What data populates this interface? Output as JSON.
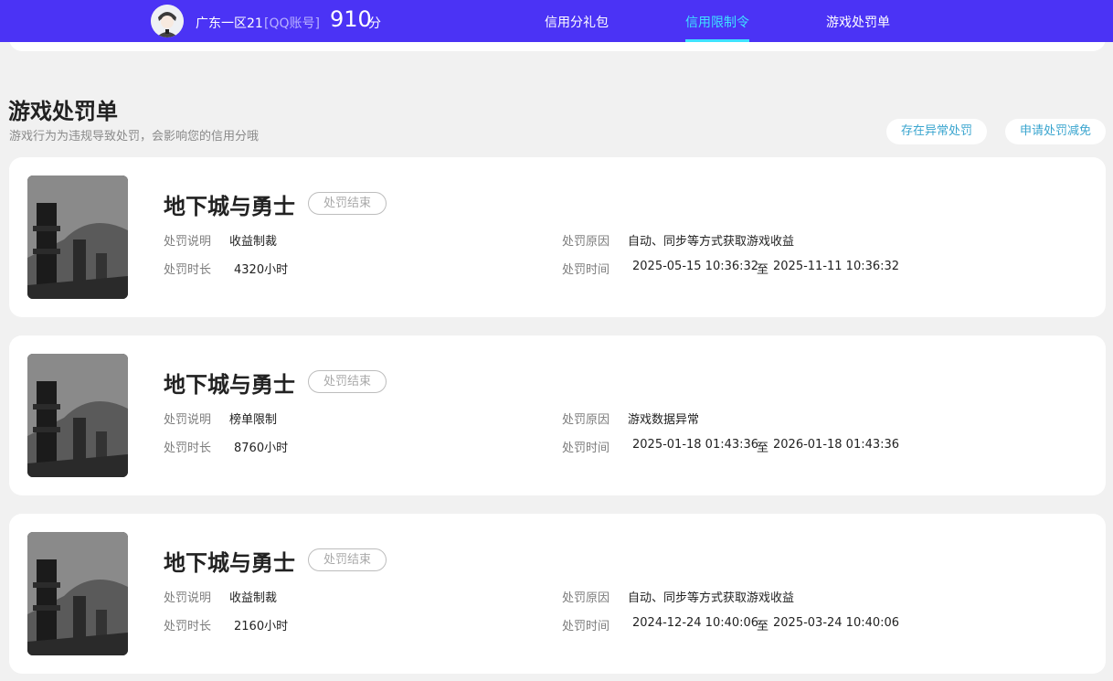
{
  "header": {
    "user_name": "广东一区21",
    "account_type": "[QQ账号]",
    "score": "910",
    "score_unit": "分",
    "tabs": [
      {
        "label": "信用分礼包",
        "active": false
      },
      {
        "label": "信用限制令",
        "active": true
      },
      {
        "label": "游戏处罚单",
        "active": false
      }
    ],
    "accent_color": "#4b33f5",
    "active_color": "#3fe3ff"
  },
  "section": {
    "title": "游戏处罚单",
    "subtitle": "游戏行为为违规导致处罚，会影响您的信用分哦",
    "buttons": {
      "abnormal": "存在异常处罚",
      "appeal": "申请处罚减免"
    }
  },
  "labels": {
    "desc": "处罚说明",
    "reason": "处罚原因",
    "duration": "处罚时长",
    "time": "处罚时间",
    "to": "至"
  },
  "penalties": [
    {
      "game": "地下城与勇士",
      "status": "处罚结束",
      "desc": "收益制裁",
      "reason": "自动、同步等方式获取游戏收益",
      "duration": "4320小时",
      "start": "2025-05-15 10:36:32",
      "end": "2025-11-11 10:36:32"
    },
    {
      "game": "地下城与勇士",
      "status": "处罚结束",
      "desc": "榜单限制",
      "reason": "游戏数据异常",
      "duration": "8760小时",
      "start": "2025-01-18 01:43:36",
      "end": "2026-01-18 01:43:36"
    },
    {
      "game": "地下城与勇士",
      "status": "处罚结束",
      "desc": "收益制裁",
      "reason": "自动、同步等方式获取游戏收益",
      "duration": "2160小时",
      "start": "2024-12-24 10:40:06",
      "end": "2025-03-24 10:40:06"
    }
  ]
}
